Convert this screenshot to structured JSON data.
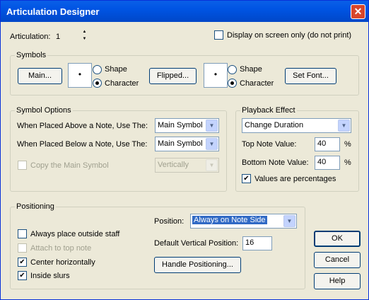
{
  "window": {
    "title": "Articulation Designer",
    "close_glyph": "✕"
  },
  "articulation": {
    "label": "Articulation:",
    "value": "1"
  },
  "display_only": {
    "label": "Display on screen only (do not print)",
    "checked": false
  },
  "symbols": {
    "legend": "Symbols",
    "main_button": "Main...",
    "main_preview": "•",
    "main_shape_label": "Shape",
    "main_character_label": "Character",
    "flipped_button": "Flipped...",
    "flipped_preview": "•",
    "flipped_shape_label": "Shape",
    "flipped_character_label": "Character",
    "set_font_button": "Set Font..."
  },
  "symbol_options": {
    "legend": "Symbol Options",
    "above_label": "When Placed Above a Note, Use The:",
    "above_value": "Main Symbol",
    "below_label": "When Placed Below a Note, Use The:",
    "below_value": "Main Symbol",
    "copy_label": "Copy the Main Symbol",
    "copy_value": "Vertically"
  },
  "playback": {
    "legend": "Playback Effect",
    "effect_value": "Change Duration",
    "top_label": "Top Note Value:",
    "top_value": "40",
    "top_unit": "%",
    "bottom_label": "Bottom Note Value:",
    "bottom_value": "40",
    "bottom_unit": "%",
    "percent_label": "Values are percentages",
    "percent_checked": true
  },
  "positioning": {
    "legend": "Positioning",
    "position_label": "Position:",
    "position_value": "Always on Note Side",
    "outside_label": "Always place outside staff",
    "attach_label": "Attach to top note",
    "center_label": "Center horizontally",
    "slurs_label": "Inside slurs",
    "default_vert_label": "Default Vertical Position:",
    "default_vert_value": "16",
    "handle_button": "Handle Positioning..."
  },
  "buttons": {
    "ok": "OK",
    "cancel": "Cancel",
    "help": "Help"
  },
  "check_glyph": "✔",
  "arrow_glyph": "▼",
  "spin_up": "▲",
  "spin_down": "▼"
}
